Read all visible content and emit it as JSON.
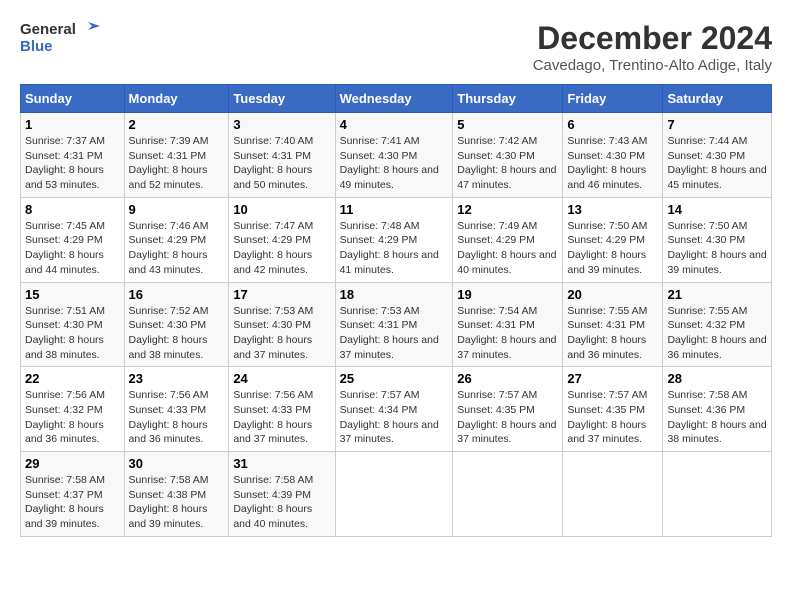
{
  "header": {
    "logo_line1": "General",
    "logo_line2": "Blue",
    "title": "December 2024",
    "subtitle": "Cavedago, Trentino-Alto Adige, Italy"
  },
  "days_of_week": [
    "Sunday",
    "Monday",
    "Tuesday",
    "Wednesday",
    "Thursday",
    "Friday",
    "Saturday"
  ],
  "weeks": [
    [
      {
        "day": "1",
        "sunrise": "7:37 AM",
        "sunset": "4:31 PM",
        "daylight": "8 hours and 53 minutes."
      },
      {
        "day": "2",
        "sunrise": "7:39 AM",
        "sunset": "4:31 PM",
        "daylight": "8 hours and 52 minutes."
      },
      {
        "day": "3",
        "sunrise": "7:40 AM",
        "sunset": "4:31 PM",
        "daylight": "8 hours and 50 minutes."
      },
      {
        "day": "4",
        "sunrise": "7:41 AM",
        "sunset": "4:30 PM",
        "daylight": "8 hours and 49 minutes."
      },
      {
        "day": "5",
        "sunrise": "7:42 AM",
        "sunset": "4:30 PM",
        "daylight": "8 hours and 47 minutes."
      },
      {
        "day": "6",
        "sunrise": "7:43 AM",
        "sunset": "4:30 PM",
        "daylight": "8 hours and 46 minutes."
      },
      {
        "day": "7",
        "sunrise": "7:44 AM",
        "sunset": "4:30 PM",
        "daylight": "8 hours and 45 minutes."
      }
    ],
    [
      {
        "day": "8",
        "sunrise": "7:45 AM",
        "sunset": "4:29 PM",
        "daylight": "8 hours and 44 minutes."
      },
      {
        "day": "9",
        "sunrise": "7:46 AM",
        "sunset": "4:29 PM",
        "daylight": "8 hours and 43 minutes."
      },
      {
        "day": "10",
        "sunrise": "7:47 AM",
        "sunset": "4:29 PM",
        "daylight": "8 hours and 42 minutes."
      },
      {
        "day": "11",
        "sunrise": "7:48 AM",
        "sunset": "4:29 PM",
        "daylight": "8 hours and 41 minutes."
      },
      {
        "day": "12",
        "sunrise": "7:49 AM",
        "sunset": "4:29 PM",
        "daylight": "8 hours and 40 minutes."
      },
      {
        "day": "13",
        "sunrise": "7:50 AM",
        "sunset": "4:29 PM",
        "daylight": "8 hours and 39 minutes."
      },
      {
        "day": "14",
        "sunrise": "7:50 AM",
        "sunset": "4:30 PM",
        "daylight": "8 hours and 39 minutes."
      }
    ],
    [
      {
        "day": "15",
        "sunrise": "7:51 AM",
        "sunset": "4:30 PM",
        "daylight": "8 hours and 38 minutes."
      },
      {
        "day": "16",
        "sunrise": "7:52 AM",
        "sunset": "4:30 PM",
        "daylight": "8 hours and 38 minutes."
      },
      {
        "day": "17",
        "sunrise": "7:53 AM",
        "sunset": "4:30 PM",
        "daylight": "8 hours and 37 minutes."
      },
      {
        "day": "18",
        "sunrise": "7:53 AM",
        "sunset": "4:31 PM",
        "daylight": "8 hours and 37 minutes."
      },
      {
        "day": "19",
        "sunrise": "7:54 AM",
        "sunset": "4:31 PM",
        "daylight": "8 hours and 37 minutes."
      },
      {
        "day": "20",
        "sunrise": "7:55 AM",
        "sunset": "4:31 PM",
        "daylight": "8 hours and 36 minutes."
      },
      {
        "day": "21",
        "sunrise": "7:55 AM",
        "sunset": "4:32 PM",
        "daylight": "8 hours and 36 minutes."
      }
    ],
    [
      {
        "day": "22",
        "sunrise": "7:56 AM",
        "sunset": "4:32 PM",
        "daylight": "8 hours and 36 minutes."
      },
      {
        "day": "23",
        "sunrise": "7:56 AM",
        "sunset": "4:33 PM",
        "daylight": "8 hours and 36 minutes."
      },
      {
        "day": "24",
        "sunrise": "7:56 AM",
        "sunset": "4:33 PM",
        "daylight": "8 hours and 37 minutes."
      },
      {
        "day": "25",
        "sunrise": "7:57 AM",
        "sunset": "4:34 PM",
        "daylight": "8 hours and 37 minutes."
      },
      {
        "day": "26",
        "sunrise": "7:57 AM",
        "sunset": "4:35 PM",
        "daylight": "8 hours and 37 minutes."
      },
      {
        "day": "27",
        "sunrise": "7:57 AM",
        "sunset": "4:35 PM",
        "daylight": "8 hours and 37 minutes."
      },
      {
        "day": "28",
        "sunrise": "7:58 AM",
        "sunset": "4:36 PM",
        "daylight": "8 hours and 38 minutes."
      }
    ],
    [
      {
        "day": "29",
        "sunrise": "7:58 AM",
        "sunset": "4:37 PM",
        "daylight": "8 hours and 39 minutes."
      },
      {
        "day": "30",
        "sunrise": "7:58 AM",
        "sunset": "4:38 PM",
        "daylight": "8 hours and 39 minutes."
      },
      {
        "day": "31",
        "sunrise": "7:58 AM",
        "sunset": "4:39 PM",
        "daylight": "8 hours and 40 minutes."
      },
      null,
      null,
      null,
      null
    ]
  ],
  "labels": {
    "sunrise": "Sunrise:",
    "sunset": "Sunset:",
    "daylight": "Daylight:"
  }
}
